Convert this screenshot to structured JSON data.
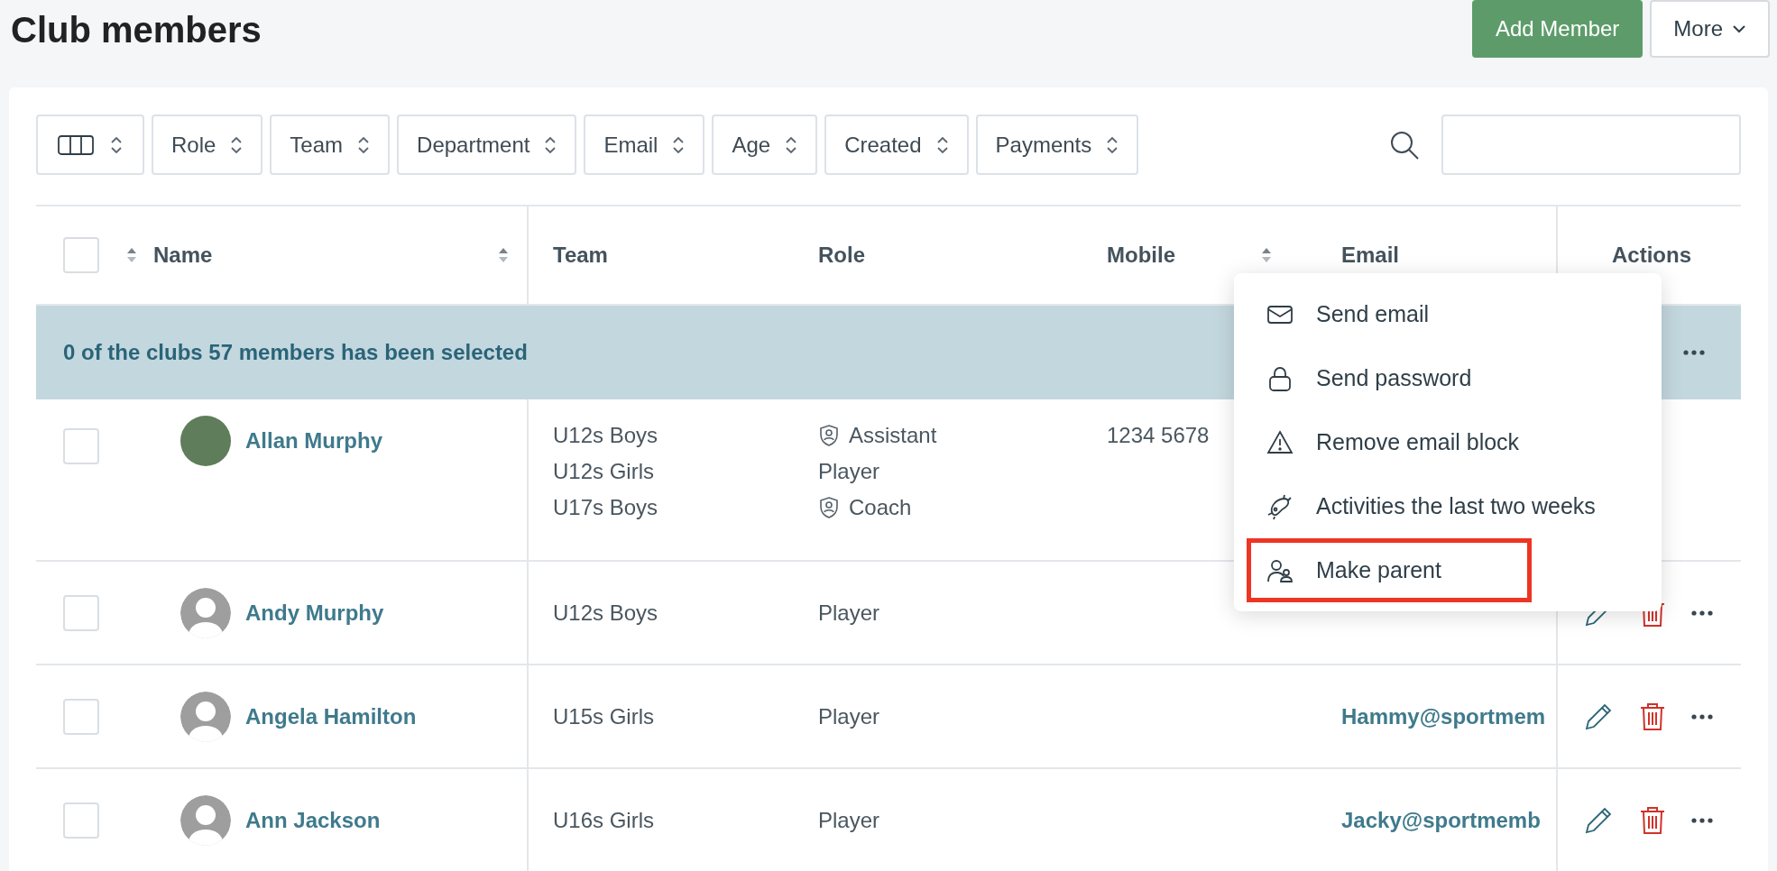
{
  "page": {
    "title": "Club members"
  },
  "header_buttons": [
    {
      "label": "Add Member",
      "kind": "primary"
    },
    {
      "label": "More",
      "kind": "dropdown"
    }
  ],
  "filters": [
    "Role",
    "Team",
    "Department",
    "Email",
    "Age",
    "Created",
    "Payments"
  ],
  "table": {
    "columns": [
      {
        "label": "Name",
        "sortable": true
      },
      {
        "label": "Team",
        "sortable": false
      },
      {
        "label": "Role",
        "sortable": false
      },
      {
        "label": "Mobile",
        "sortable": true
      },
      {
        "label": "Email",
        "sortable": false
      },
      {
        "label": "Actions",
        "sortable": false
      }
    ],
    "select_all_checked": false,
    "selection_banner": "0 of the clubs 57 members has been selected",
    "rows": [
      {
        "checked": false,
        "kind": "photo",
        "name": "Allan Murphy",
        "teams": [
          "U12s Boys",
          "U12s Girls",
          "U17s Boys"
        ],
        "roles": [
          {
            "text": "Assistant",
            "kind": "staff"
          },
          {
            "text": "Player",
            "kind": "plain"
          },
          {
            "text": "Coach",
            "kind": "staff"
          }
        ],
        "mobile": "1234 5678",
        "email": ""
      },
      {
        "checked": false,
        "kind": "silhouette",
        "name": "Andy Murphy",
        "teams": [
          "U12s Boys"
        ],
        "roles": [
          {
            "text": "Player",
            "kind": "plain"
          }
        ],
        "mobile": "",
        "email": ""
      },
      {
        "checked": false,
        "kind": "silhouette",
        "name": "Angela Hamilton",
        "teams": [
          "U15s Girls"
        ],
        "roles": [
          {
            "text": "Player",
            "kind": "plain"
          }
        ],
        "mobile": "",
        "email": "Hammy@sportmem"
      },
      {
        "checked": false,
        "kind": "silhouette",
        "name": "Ann Jackson",
        "teams": [
          "U16s Girls"
        ],
        "roles": [
          {
            "text": "Player",
            "kind": "plain"
          }
        ],
        "mobile": "",
        "email": "Jacky@sportmemb"
      }
    ]
  },
  "context_menu": {
    "items": [
      {
        "label": "Send email",
        "kind": "mail",
        "highlighted": false
      },
      {
        "label": "Send password",
        "kind": "lock",
        "highlighted": false
      },
      {
        "label": "Remove email block",
        "kind": "warning",
        "highlighted": false
      },
      {
        "label": "Activities the last two weeks",
        "kind": "activity",
        "highlighted": false
      },
      {
        "label": "Make parent",
        "kind": "parent",
        "highlighted": true
      }
    ]
  }
}
